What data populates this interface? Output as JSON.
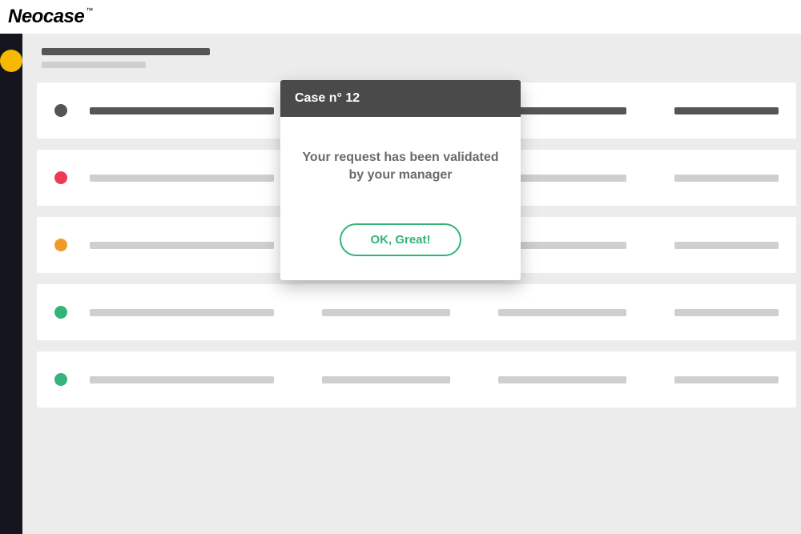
{
  "brand": {
    "name": "Neocase"
  },
  "sidebar": {
    "active_color": "#f6b900"
  },
  "rows": [
    {
      "status_color": "#555555",
      "active": true
    },
    {
      "status_color": "#ef3a54",
      "active": false
    },
    {
      "status_color": "#f19a2c",
      "active": false
    },
    {
      "status_color": "#34b37a",
      "active": false
    },
    {
      "status_color": "#34b37a",
      "active": false
    }
  ],
  "modal": {
    "title": "Case n° 12",
    "message": "Your request has been validated by your manager",
    "button_label": "OK, Great!",
    "accent": "#34b37a"
  }
}
